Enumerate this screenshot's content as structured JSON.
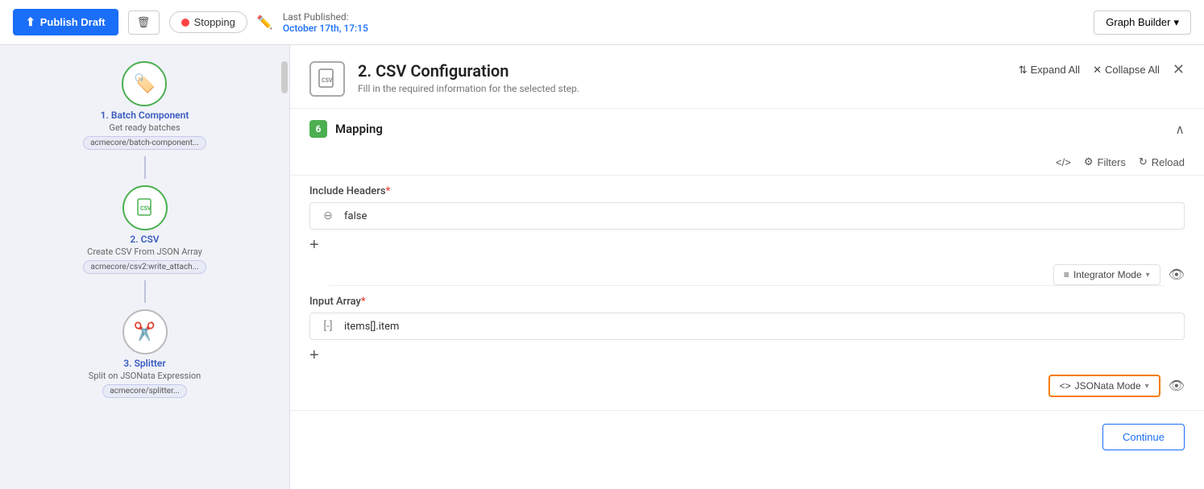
{
  "topbar": {
    "publish_label": "Publish Draft",
    "stopping_label": "Stopping",
    "last_published_label": "Last Published:",
    "last_published_date": "October 17th, 17:15",
    "graph_builder_label": "Graph Builder"
  },
  "sidebar": {
    "nodes": [
      {
        "id": "batch",
        "label": "1. Batch Component",
        "sublabel": "Get ready batches",
        "tag": "acmecore/batch-component...",
        "icon": "🏷️",
        "style": "green"
      },
      {
        "id": "csv",
        "label": "2. CSV",
        "sublabel": "Create CSV From JSON Array",
        "tag": "acmecore/csv2:write_attach...",
        "icon": "📄",
        "style": "green-active"
      },
      {
        "id": "splitter",
        "label": "3. Splitter",
        "sublabel": "Split on JSONata Expression",
        "tag": "acmecore/splitter...",
        "icon": "✂️",
        "style": "scissors"
      }
    ]
  },
  "config": {
    "title": "2. CSV Configuration",
    "subtitle": "Fill in the required information for the selected step.",
    "expand_all_label": "Expand All",
    "collapse_all_label": "Collapse All",
    "section": {
      "badge": "6",
      "title": "Mapping",
      "fields": {
        "include_headers_label": "Include Headers",
        "include_headers_required": true,
        "include_headers_value": "false",
        "input_array_label": "Input Array",
        "input_array_required": true,
        "input_array_value": "items[].item"
      }
    },
    "toolbar": {
      "code_label": "",
      "filters_label": "Filters",
      "reload_label": "Reload"
    },
    "integrator_mode_label": "Integrator Mode",
    "jsonata_mode_label": "JSONata Mode",
    "continue_label": "Continue"
  }
}
